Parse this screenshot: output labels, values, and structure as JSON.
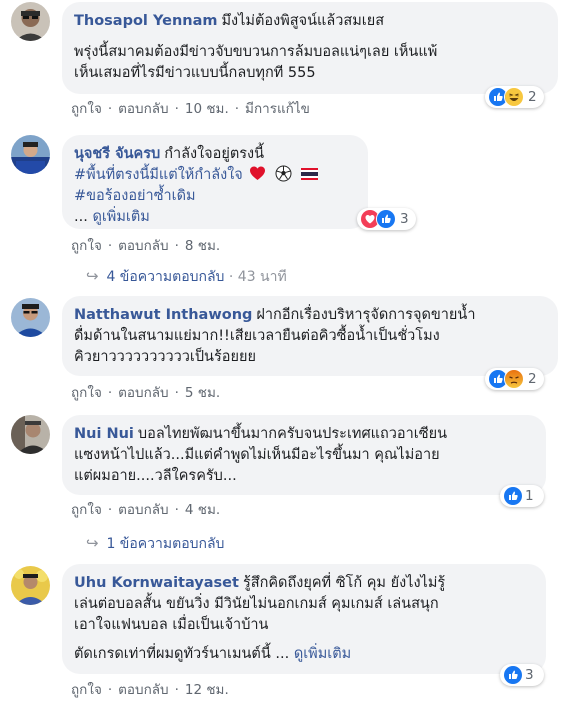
{
  "comments": [
    {
      "author": "Thosapol Yennam",
      "lines": [
        "มึงไม่ต้องพิสูจน์แล้วสมเยส",
        "",
        "พรุ่งนี้สมาคมต้องมีข่าวจับขบวนการล้มบอลแน่ๆเลย เห็นแพ้",
        "เห็นเสมอที่ไรมีข่าวแบบนี้กลบทุกที 555"
      ],
      "actions": {
        "like": "ถูกใจ",
        "reply": "ตอบกลับ",
        "time": "10 ชม.",
        "edited": "มีการแก้ไข"
      },
      "reactions": {
        "icons": [
          "like-icon",
          "haha-icon"
        ],
        "count": "2"
      }
    },
    {
      "author": "นุจชรี จันครบ",
      "first_line": "กำลังใจอยู่ตรงนี้",
      "hashtag1": "#พื้นที่ตรงนี้มีแต่ให้กำลังใจ",
      "hashtag2": "#ขอร้องอย่าซ้ำเดิม",
      "more_prefix": "...",
      "more_link": "ดูเพิ่มเติม",
      "actions": {
        "like": "ถูกใจ",
        "reply": "ตอบกลับ",
        "time": "8 ชม."
      },
      "reactions": {
        "icons": [
          "love-icon",
          "like-icon"
        ],
        "count": "3"
      },
      "replies": {
        "label": "4 ข้อความตอบกลับ",
        "meta": "43 นาที"
      }
    },
    {
      "author": "Natthawut Inthawong",
      "lines": [
        "ฝากอีกเรื่องบริหารุจัดการจุดขายน้ำ",
        "ดื่มด้านในสนามแย่มาก!!เสียเวลายืนต่อคิวซื้อน้ำเป็นชั่วโมง",
        "คิวยาววววววววววเป็นร้อยยย"
      ],
      "actions": {
        "like": "ถูกใจ",
        "reply": "ตอบกลับ",
        "time": "5 ชม."
      },
      "reactions": {
        "icons": [
          "like-icon",
          "angry-icon"
        ],
        "count": "2"
      }
    },
    {
      "author": "Nui Nui",
      "lines": [
        "บอลไทยพัฒนาขึ้นมากครับจนประเทศแถวอาเซียน",
        "แซงหน้าไปแล้ว...มีแต่คำพูดไม่เห็นมีอะไรขึ้นมา คุณไม่อาย",
        "แต่ผมอาย....วลีใครครับ..."
      ],
      "actions": {
        "like": "ถูกใจ",
        "reply": "ตอบกลับ",
        "time": "4 ชม."
      },
      "reactions": {
        "icons": [
          "like-icon"
        ],
        "count": "1"
      },
      "replies": {
        "label": "1 ข้อความตอบกลับ"
      }
    },
    {
      "author": "Uhu Kornwaitayaset",
      "lines": [
        "รู้สึกคิดถึงยุคที่ ซิโก้ คุม ยังไงไม่รู้",
        "เล่นต่อบอลสั้น ขยันวิ่ง มีวินัยไม่นอกเกมส์ คุมเกมส์ เล่นสนุก",
        "เอาใจแฟนบอล เมื่อเป็นเจ้าบ้าน",
        "",
        "ตัดเกรดเท่าที่ผมดูทัวร์นาเมนต์นี้"
      ],
      "more_prefix": "...",
      "more_link": "ดูเพิ่มเติม",
      "actions": {
        "like": "ถูกใจ",
        "reply": "ตอบกลับ",
        "time": "12 ชม."
      },
      "reactions": {
        "icons": [
          "like-icon"
        ],
        "count": "3"
      }
    }
  ],
  "colors": {
    "link": "#385898",
    "bubble": "#f2f3f5",
    "meta": "#606770",
    "like": "#1877f2"
  }
}
